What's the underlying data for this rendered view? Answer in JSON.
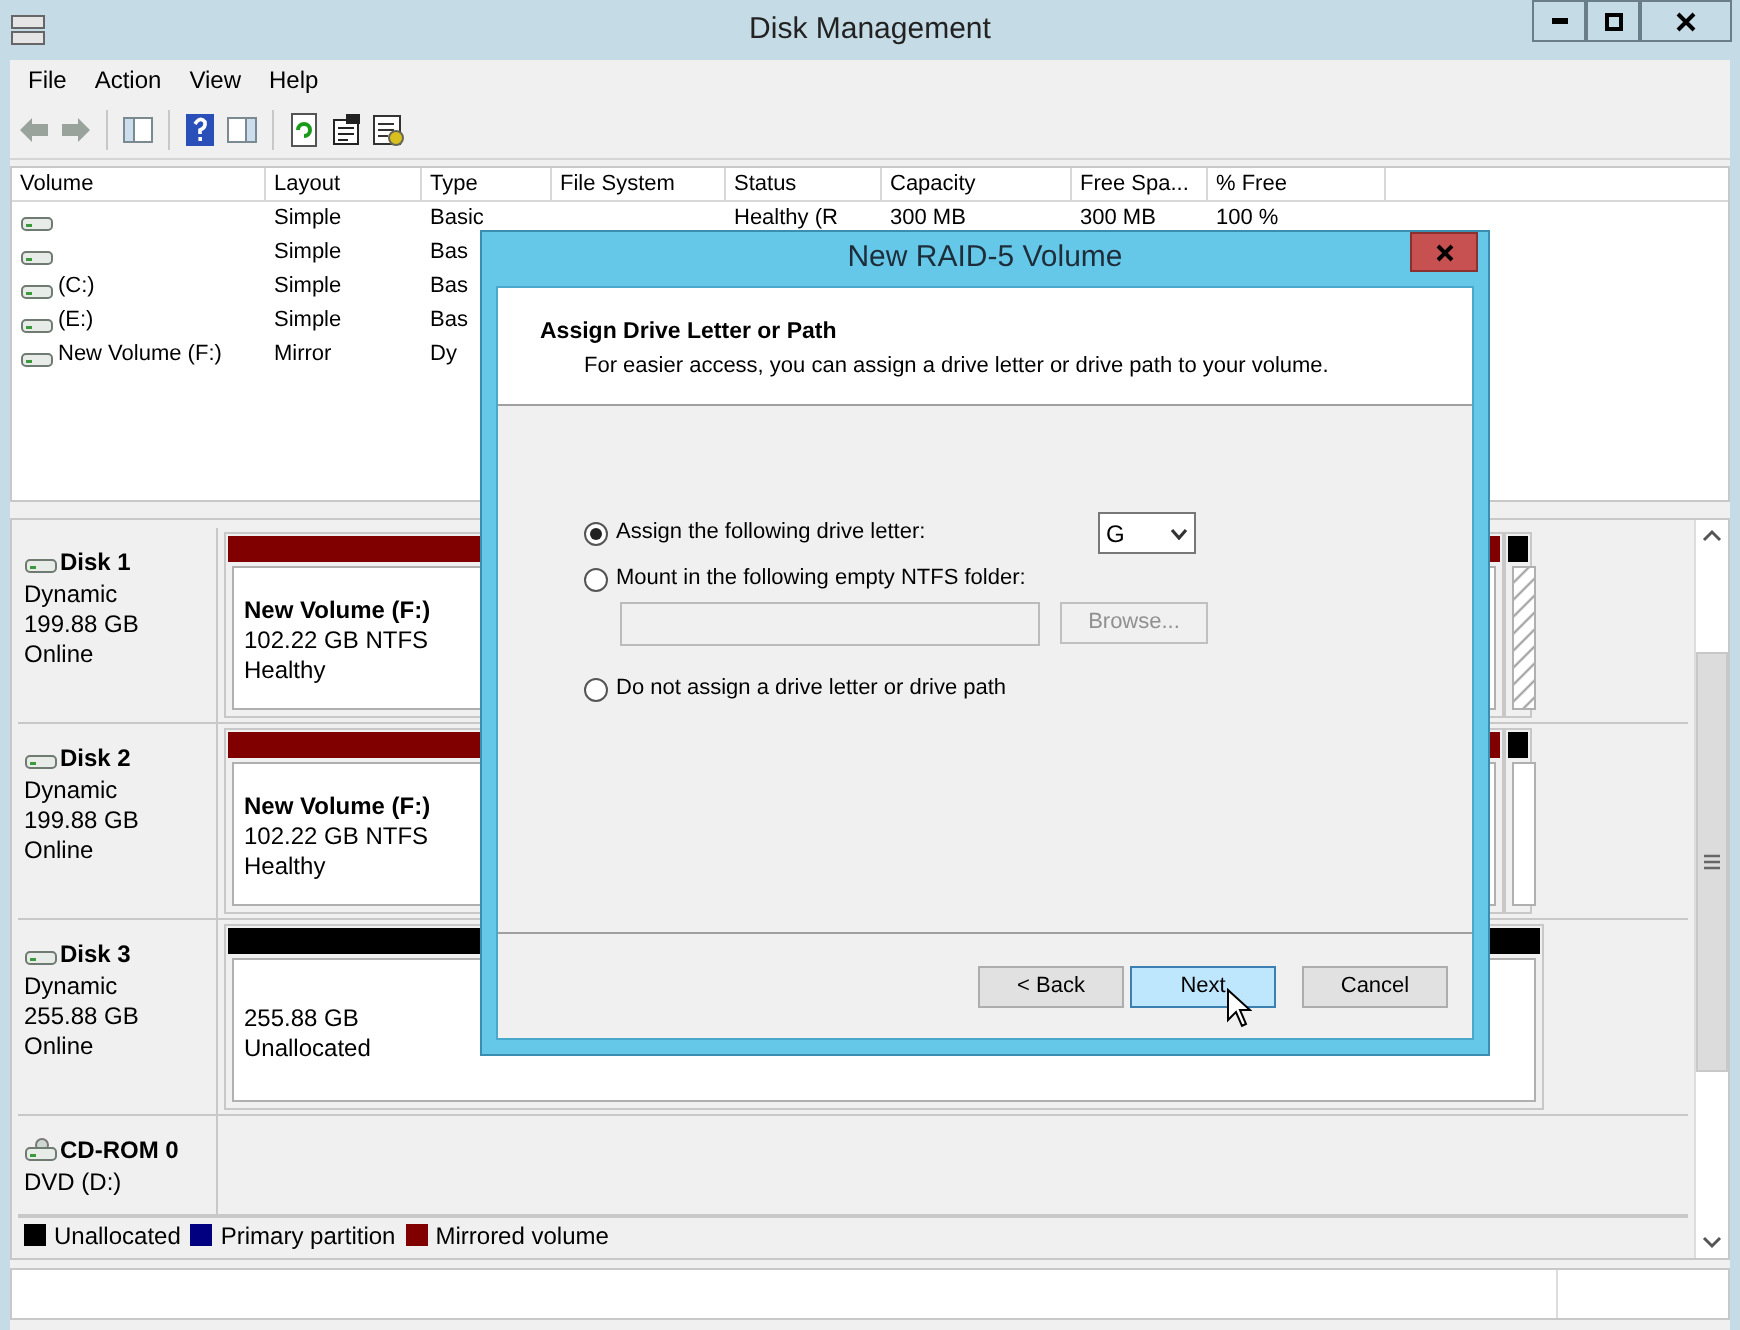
{
  "window": {
    "title": "Disk Management"
  },
  "menu": [
    "File",
    "Action",
    "View",
    "Help"
  ],
  "table": {
    "columns": [
      "Volume",
      "Layout",
      "Type",
      "File System",
      "Status",
      "Capacity",
      "Free Spa...",
      "% Free"
    ],
    "rows": [
      [
        "",
        "Simple",
        "Basic",
        "",
        "Healthy (R",
        "300 MB",
        "300 MB",
        "100 %"
      ],
      [
        "",
        "Simple",
        "Bas"
      ],
      [
        "(C:)",
        "Simple",
        "Bas"
      ],
      [
        "(E:)",
        "Simple",
        "Bas"
      ],
      [
        "New Volume (F:)",
        "Mirror",
        "Dy"
      ]
    ]
  },
  "disks": [
    {
      "name": "Disk 1",
      "kind": "disk",
      "lines": [
        "Dynamic",
        "199.88 GB",
        "Online"
      ],
      "partitions": [
        {
          "color": "#800000",
          "selected": false,
          "lines": [
            "New Volume  (F:)",
            "102.22 GB NTFS",
            "Healthy"
          ]
        },
        {
          "color": "#000000",
          "selected": true
        }
      ]
    },
    {
      "name": "Disk 2",
      "kind": "disk",
      "lines": [
        "Dynamic",
        "199.88 GB",
        "Online"
      ],
      "partitions": [
        {
          "color": "#800000",
          "selected": false,
          "lines": [
            "New Volume  (F:)",
            "102.22 GB NTFS",
            "Healthy"
          ]
        },
        {
          "color": "#000000",
          "selected": false
        }
      ]
    },
    {
      "name": "Disk 3",
      "kind": "disk",
      "lines": [
        "Dynamic",
        "255.88 GB",
        "Online"
      ],
      "partitions": [
        {
          "color": "#000000",
          "selected": false,
          "lines": [
            "255.88 GB",
            "Unallocated"
          ]
        }
      ]
    },
    {
      "name": "CD-ROM 0",
      "kind": "cdrom",
      "lines": [
        "DVD (D:)"
      ]
    }
  ],
  "legend": [
    {
      "label": "Unallocated",
      "color": "#000000"
    },
    {
      "label": "Primary partition",
      "color": "#000080"
    },
    {
      "label": "Mirrored volume",
      "color": "#800000"
    }
  ],
  "dialog": {
    "title": "New RAID-5 Volume",
    "heading": "Assign Drive Letter or Path",
    "subheading": "For easier access, you can assign a drive letter or drive path to your volume.",
    "options": [
      {
        "label": "Assign the following drive letter:",
        "selected": true,
        "kind": "letter",
        "value": "G"
      },
      {
        "label": "Mount in the following empty NTFS folder:",
        "selected": false,
        "kind": "folder",
        "button": "Browse..."
      },
      {
        "label": "Do not assign a drive letter or drive path",
        "selected": false,
        "kind": "none"
      }
    ],
    "buttons": [
      {
        "label": "< Back",
        "focused": false
      },
      {
        "label": "Next",
        "focused": true
      },
      {
        "label": "Cancel",
        "focused": false
      }
    ]
  }
}
